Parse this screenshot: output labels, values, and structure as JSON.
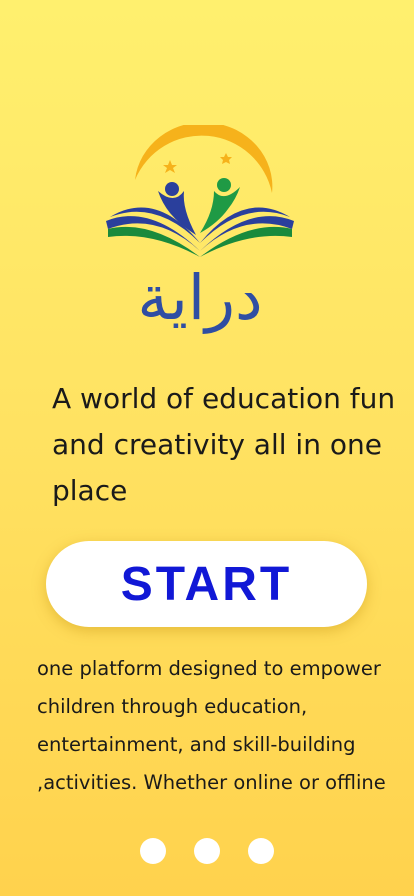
{
  "logo": {
    "wordmark": "دراية",
    "colors": {
      "arc": "#f6b21b",
      "book_blue": "#2a3f9c",
      "book_green": "#1a8a3c",
      "figure_blue": "#2a3f9c",
      "figure_green": "#1f9a45",
      "star": "#f6b21b",
      "wordmark": "#2f4ea3"
    }
  },
  "headline": "A world of education fun and creativity all in one place",
  "start_button": {
    "label": "START",
    "color": "#1118d6"
  },
  "description": {
    "lines": [
      "one platform designed to empower",
      "children through education,",
      "entertainment, and skill-building",
      ",activities. Whether online or offline"
    ]
  },
  "pagination": {
    "dots": [
      {
        "name": "page-dot-1",
        "active": false
      },
      {
        "name": "page-dot-2",
        "active": false
      },
      {
        "name": "page-dot-3",
        "active": false
      }
    ]
  },
  "background": {
    "top": "#fff06e",
    "bottom": "#ffd24d"
  }
}
